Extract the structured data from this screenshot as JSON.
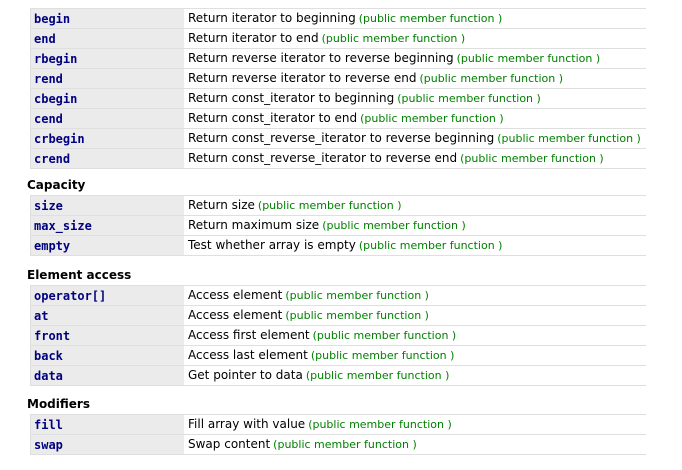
{
  "sections": [
    {
      "heading": "",
      "rows": [
        {
          "name": "begin",
          "desc": "Return iterator to beginning",
          "kind": "(public member function )"
        },
        {
          "name": "end",
          "desc": "Return iterator to end",
          "kind": "(public member function )"
        },
        {
          "name": "rbegin",
          "desc": "Return reverse iterator to reverse beginning",
          "kind": "(public member function )"
        },
        {
          "name": "rend",
          "desc": "Return reverse iterator to reverse end",
          "kind": "(public member function )"
        },
        {
          "name": "cbegin",
          "desc": "Return const_iterator to beginning",
          "kind": "(public member function )"
        },
        {
          "name": "cend",
          "desc": "Return const_iterator to end",
          "kind": "(public member function )"
        },
        {
          "name": "crbegin",
          "desc": "Return const_reverse_iterator to reverse beginning",
          "kind": "(public member function )"
        },
        {
          "name": "crend",
          "desc": "Return const_reverse_iterator to reverse end",
          "kind": "(public member function )"
        }
      ]
    },
    {
      "heading": "Capacity",
      "rows": [
        {
          "name": "size",
          "desc": "Return size",
          "kind": "(public member function )"
        },
        {
          "name": "max_size",
          "desc": "Return maximum size",
          "kind": "(public member function )"
        },
        {
          "name": "empty",
          "desc": "Test whether array is empty",
          "kind": "(public member function )"
        }
      ]
    },
    {
      "heading": "Element access",
      "rows": [
        {
          "name": "operator[]",
          "desc": "Access element",
          "kind": "(public member function )"
        },
        {
          "name": "at",
          "desc": "Access element",
          "kind": "(public member function )"
        },
        {
          "name": "front",
          "desc": "Access first element",
          "kind": "(public member function )"
        },
        {
          "name": "back",
          "desc": "Access last element",
          "kind": "(public member function )"
        },
        {
          "name": "data",
          "desc": "Get pointer to data",
          "kind": "(public member function )"
        }
      ]
    },
    {
      "heading": "Modifiers",
      "rows": [
        {
          "name": "fill",
          "desc": "Fill array with value",
          "kind": "(public member function )"
        },
        {
          "name": "swap",
          "desc": "Swap content",
          "kind": "(public member function )"
        }
      ]
    }
  ],
  "colors": {
    "link": "#000080",
    "kind": "#008000",
    "name_cell_bg": "#ebebeb",
    "border": "#dfdfdf"
  }
}
